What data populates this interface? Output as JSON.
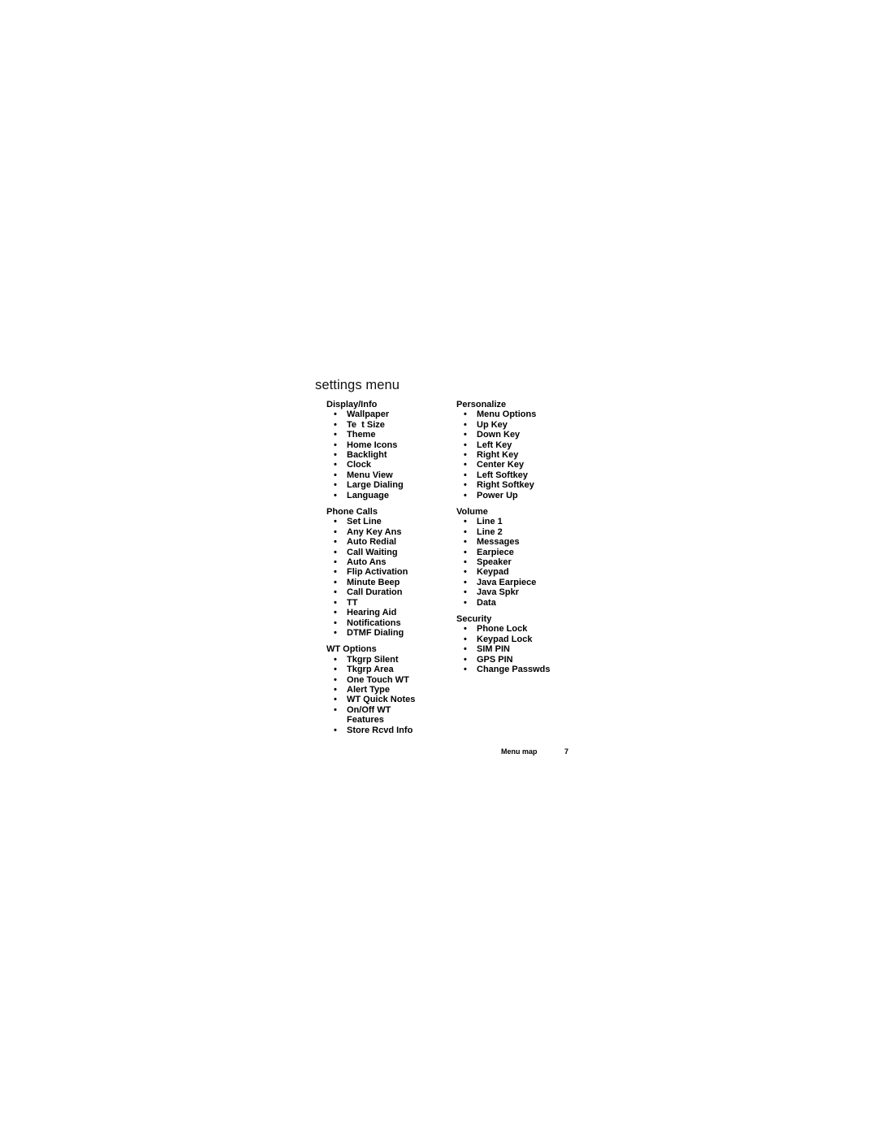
{
  "title": "settings menu",
  "left_column": [
    {
      "heading": "Display/Info",
      "items": [
        "Wallpaper",
        "Te  t Size",
        "Theme",
        "Home Icons",
        "Backlight",
        "Clock",
        "Menu View",
        "Large Dialing",
        "Language"
      ]
    },
    {
      "heading": "Phone Calls",
      "items": [
        "Set Line",
        "Any Key Ans",
        "Auto Redial",
        "Call Waiting",
        "Auto Ans",
        "Flip Activation",
        "Minute Beep",
        "Call Duration",
        "TT",
        "Hearing Aid",
        "Notifications",
        "DTMF Dialing"
      ]
    },
    {
      "heading": "WT Options",
      "items": [
        "Tkgrp Silent",
        "Tkgrp Area",
        "One Touch WT",
        "Alert Type",
        "WT Quick Notes",
        "On/Off WT Features",
        "Store Rcvd Info"
      ]
    }
  ],
  "right_column": [
    {
      "heading": "Personalize",
      "items": [
        "Menu Options",
        "Up Key",
        "Down Key",
        "Left Key",
        "Right Key",
        "Center Key",
        "Left Softkey",
        "Right Softkey",
        "Power Up"
      ]
    },
    {
      "heading": "Volume",
      "items": [
        "Line 1",
        "Line 2",
        "Messages",
        "Earpiece",
        "Speaker",
        "Keypad",
        "Java Earpiece",
        "Java Spkr",
        "Data"
      ]
    },
    {
      "heading": "Security",
      "items": [
        "Phone Lock",
        "Keypad Lock",
        "SIM PIN",
        "GPS PIN",
        "Change Passwds"
      ]
    }
  ],
  "bullet": "•",
  "footer": {
    "section_label": "Menu map",
    "page_number": "7"
  }
}
